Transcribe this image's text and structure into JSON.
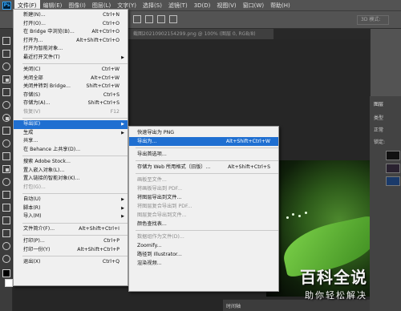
{
  "menubar": {
    "items": [
      "文件(F)",
      "编辑(E)",
      "图像(I)",
      "图层(L)",
      "文字(Y)",
      "选择(S)",
      "滤镜(T)",
      "3D(D)",
      "视图(V)",
      "窗口(W)",
      "帮助(H)"
    ],
    "active_index": 0
  },
  "options_bar": {
    "mode_3d_label": "3D 模式:"
  },
  "document_tab": {
    "title": "截图20210902154299.png @ 100% (图层 0, RGB/8)"
  },
  "file_menu": {
    "groups": [
      [
        {
          "label": "新建(N)...",
          "shortcut": "Ctrl+N"
        },
        {
          "label": "打开(O)...",
          "shortcut": "Ctrl+O"
        },
        {
          "label": "在 Bridge 中浏览(B)...",
          "shortcut": "Alt+Ctrl+O"
        },
        {
          "label": "打开为...",
          "shortcut": "Alt+Shift+Ctrl+O"
        },
        {
          "label": "打开为智能对象...",
          "shortcut": ""
        },
        {
          "label": "最近打开文件(T)",
          "shortcut": "",
          "submenu": true
        }
      ],
      [
        {
          "label": "关闭(C)",
          "shortcut": "Ctrl+W"
        },
        {
          "label": "关闭全部",
          "shortcut": "Alt+Ctrl+W"
        },
        {
          "label": "关闭并转到 Bridge...",
          "shortcut": "Shift+Ctrl+W"
        },
        {
          "label": "存储(S)",
          "shortcut": "Ctrl+S"
        },
        {
          "label": "存储为(A)...",
          "shortcut": "Shift+Ctrl+S"
        },
        {
          "label": "恢复(V)",
          "shortcut": "F12",
          "disabled": true
        }
      ],
      [
        {
          "label": "导出(E)",
          "shortcut": "",
          "submenu": true,
          "highlighted": true
        },
        {
          "label": "生成",
          "shortcut": "",
          "submenu": true
        },
        {
          "label": "共享...",
          "shortcut": ""
        },
        {
          "label": "在 Behance 上共享(D)...",
          "shortcut": ""
        }
      ],
      [
        {
          "label": "搜索 Adobe Stock...",
          "shortcut": ""
        },
        {
          "label": "置入嵌入对象(L)...",
          "shortcut": ""
        },
        {
          "label": "置入链接的智能对象(K)...",
          "shortcut": ""
        },
        {
          "label": "打包(G)...",
          "shortcut": "",
          "disabled": true
        }
      ],
      [
        {
          "label": "自动(U)",
          "shortcut": "",
          "submenu": true
        },
        {
          "label": "脚本(R)",
          "shortcut": "",
          "submenu": true
        },
        {
          "label": "导入(M)",
          "shortcut": "",
          "submenu": true
        }
      ],
      [
        {
          "label": "文件简介(F)...",
          "shortcut": "Alt+Shift+Ctrl+I"
        }
      ],
      [
        {
          "label": "打印(P)...",
          "shortcut": "Ctrl+P"
        },
        {
          "label": "打印一份(Y)",
          "shortcut": "Alt+Shift+Ctrl+P"
        }
      ],
      [
        {
          "label": "退出(X)",
          "shortcut": "Ctrl+Q"
        }
      ]
    ]
  },
  "export_menu": {
    "groups": [
      [
        {
          "label": "快速导出为 PNG",
          "shortcut": ""
        },
        {
          "label": "导出为...",
          "shortcut": "Alt+Shift+Ctrl+W",
          "highlighted": true
        }
      ],
      [
        {
          "label": "导出首选项...",
          "shortcut": ""
        }
      ],
      [
        {
          "label": "存储为 Web 所用格式（旧版）...",
          "shortcut": "Alt+Shift+Ctrl+S"
        }
      ],
      [
        {
          "label": "画板至文件...",
          "shortcut": "",
          "disabled": true
        },
        {
          "label": "将画板导出到 PDF...",
          "shortcut": "",
          "disabled": true
        },
        {
          "label": "将图层导出到文件...",
          "shortcut": ""
        },
        {
          "label": "将图层复合导出到 PDF...",
          "shortcut": "",
          "disabled": true
        },
        {
          "label": "图层复合导出到文件...",
          "shortcut": "",
          "disabled": true
        },
        {
          "label": "颜色查找表...",
          "shortcut": ""
        }
      ],
      [
        {
          "label": "数据组作为文件(D)...",
          "shortcut": "",
          "disabled": true
        },
        {
          "label": "Zoomify...",
          "shortcut": ""
        },
        {
          "label": "路径到 Illustrator...",
          "shortcut": ""
        },
        {
          "label": "渲染视频...",
          "shortcut": ""
        }
      ]
    ]
  },
  "layers_panel": {
    "title": "图层",
    "kind_label": "类型",
    "blend_label": "正常",
    "lock_label": "锁定:"
  },
  "timeline": {
    "label": "时间轴"
  },
  "watermark": {
    "line1": "百科全说",
    "line2": "助你轻松解决"
  }
}
